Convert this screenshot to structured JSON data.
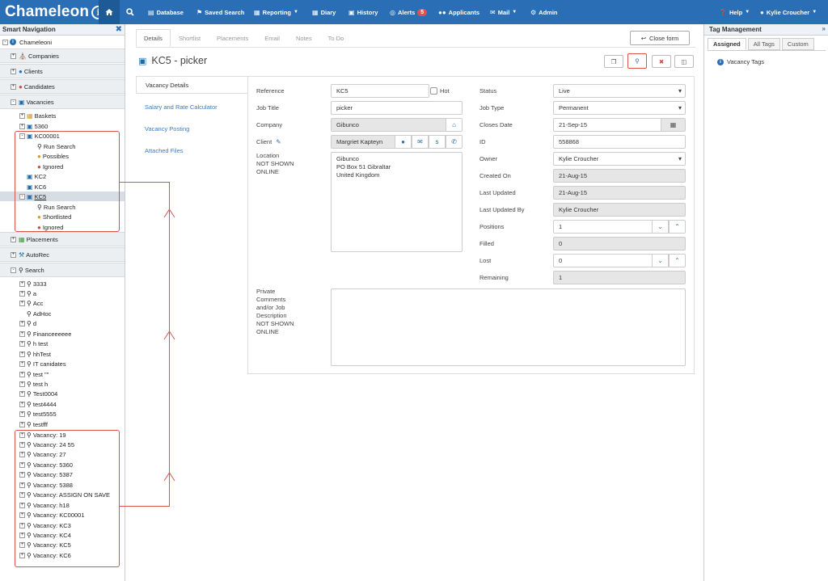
{
  "app": {
    "name": "Chameleon"
  },
  "topnav": {
    "items": [
      {
        "label": "Database",
        "icon": "database-icon"
      },
      {
        "label": "Saved Search",
        "icon": "bookmark-icon"
      },
      {
        "label": "Reporting",
        "icon": "chart-icon"
      },
      {
        "label": "Diary",
        "icon": "calendar-icon"
      },
      {
        "label": "History",
        "icon": "book-icon"
      },
      {
        "label": "Alerts",
        "icon": "bulb-icon",
        "badge": "5"
      },
      {
        "label": "Applicants",
        "icon": "users-icon"
      },
      {
        "label": "Mail",
        "icon": "envelope-icon"
      },
      {
        "label": "Admin",
        "icon": "cogs-icon"
      }
    ],
    "help_label": "Help",
    "user_label": "Kylie Croucher"
  },
  "sidebar": {
    "title": "Smart Navigation",
    "root_label": "Chameleoni",
    "sections": {
      "companies": "Companies",
      "clients": "Clients",
      "candidates": "Candidates",
      "vacancies": "Vacancies",
      "placements": "Placements",
      "autorec": "AutoRec",
      "search": "Search"
    },
    "vacancy_nodes": {
      "baskets": "Baskets",
      "v5360": "5360",
      "kc00001": "KC00001",
      "run_search": "Run Search",
      "possibles": "Possibles",
      "ignored": "Ignored",
      "kc2": "KC2",
      "kc6": "KC6",
      "kc5": "KC5",
      "run_search_2": "Run Search",
      "shortlisted": "Shortlisted",
      "ignored_2": "Ignored"
    },
    "search_items": [
      "3333",
      "a",
      "Acc",
      "AdHoc",
      "d",
      "Financeeeeee",
      "h test",
      "hhTest",
      "IT canidates",
      "test \"\"",
      "test h",
      "Test0004",
      "test4444",
      "test5555",
      "testfff"
    ],
    "vacancy_searches": [
      "Vacancy: 19",
      "Vacancy: 24 55",
      "Vacancy: 27",
      "Vacancy: 5360",
      "Vacancy: 5387",
      "Vacancy: 5388",
      "Vacancy: ASSIGN ON SAVE",
      "Vacancy: h18",
      "Vacancy: KC00001",
      "Vacancy: KC3",
      "Vacancy: KC4",
      "Vacancy: KC5",
      "Vacancy: KC6"
    ]
  },
  "tabs": [
    "Details",
    "Shortlist",
    "Placements",
    "Email",
    "Notes",
    "To Do"
  ],
  "close_form_label": "Close form",
  "record_title": "KC5 - picker",
  "vacancy_nav": [
    "Vacancy Details",
    "Salary and Rate Calculator",
    "Vacancy Posting",
    "Attached Files"
  ],
  "form": {
    "reference": {
      "label": "Reference",
      "value": "KC5"
    },
    "hot_label": "Hot",
    "job_title": {
      "label": "Job Title",
      "value": "picker"
    },
    "company": {
      "label": "Company",
      "value": "Gibunco"
    },
    "client": {
      "label": "Client",
      "value": "Margriet Kapteyn"
    },
    "location": {
      "label": "Location\nNOT SHOWN\nONLINE",
      "value": "Gibunco\nPO Box 51 Gibraltar\nUnited Kingdom"
    },
    "private_comments": {
      "label": "Private\nComments\nand/or Job\nDescription\nNOT SHOWN\nONLINE",
      "value": ""
    },
    "status": {
      "label": "Status",
      "value": "Live"
    },
    "job_type": {
      "label": "Job Type",
      "value": "Permanent"
    },
    "closes_date": {
      "label": "Closes Date",
      "value": "21-Sep-15"
    },
    "id": {
      "label": "ID",
      "value": "558868"
    },
    "owner": {
      "label": "Owner",
      "value": "Kylie Croucher"
    },
    "created_on": {
      "label": "Created On",
      "value": "21-Aug-15"
    },
    "last_updated": {
      "label": "Last Updated",
      "value": "21-Aug-15"
    },
    "last_updated_by": {
      "label": "Last Updated By",
      "value": "Kylie Croucher"
    },
    "positions": {
      "label": "Positions",
      "value": "1"
    },
    "filled": {
      "label": "Filled",
      "value": "0"
    },
    "lost": {
      "label": "Lost",
      "value": "0"
    },
    "remaining": {
      "label": "Remaining",
      "value": "1"
    }
  },
  "tag_panel": {
    "title": "Tag Management",
    "tabs": [
      "Assigned",
      "All Tags",
      "Custom"
    ],
    "item": "Vacancy Tags"
  },
  "colors": {
    "topbar": "#2a6fb5",
    "accent_link": "#3a7bbf",
    "highlight_box": "#d9534f"
  }
}
